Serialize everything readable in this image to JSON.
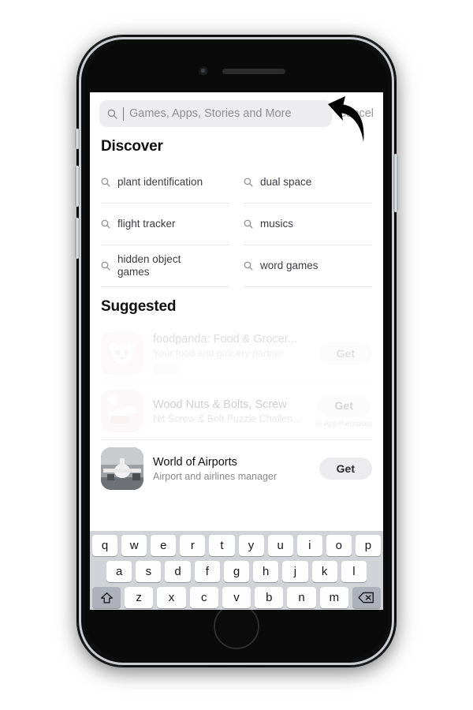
{
  "device": {
    "type": "iphone-home-button",
    "frame_color": "#111111",
    "rim_color": "#c9cdd1"
  },
  "search": {
    "placeholder": "Games, Apps, Stories and More",
    "value": "",
    "cancel_label": "Cancel",
    "icon": "search-icon"
  },
  "discover": {
    "title": "Discover",
    "items": [
      {
        "label": "plant identification",
        "icon": "search-icon"
      },
      {
        "label": "dual space",
        "icon": "search-icon"
      },
      {
        "label": "flight tracker",
        "icon": "search-icon"
      },
      {
        "label": "musics",
        "icon": "search-icon"
      },
      {
        "label": "hidden object games",
        "icon": "search-icon"
      },
      {
        "label": "word games",
        "icon": "search-icon"
      }
    ]
  },
  "suggested": {
    "title": "Suggested",
    "apps": [
      {
        "name": "foodpanda: Food & Grocer...",
        "subtitle": "Your food and grocery partner",
        "action_label": "Get",
        "note": "",
        "icon": "panda-app-icon",
        "state": "loading"
      },
      {
        "name": "Wood Nuts & Bolts, Screw",
        "subtitle": "Nit Screw & Bolt Puzzle Challenges",
        "action_label": "Get",
        "note": "In-App Purchases",
        "icon": "wood-bolts-app-icon",
        "state": "loading"
      },
      {
        "name": "World of Airports",
        "subtitle": "Airport and airlines manager",
        "action_label": "Get",
        "note": "",
        "icon": "airport-photo-app-icon",
        "state": "loaded"
      }
    ]
  },
  "keyboard": {
    "row1": [
      "q",
      "w",
      "e",
      "r",
      "t",
      "y",
      "u",
      "i",
      "o",
      "p"
    ],
    "row2": [
      "a",
      "s",
      "d",
      "f",
      "g",
      "h",
      "j",
      "k",
      "l"
    ],
    "row3": [
      "z",
      "x",
      "c",
      "v",
      "b",
      "n",
      "m"
    ],
    "shift_icon": "shift-arrow-icon",
    "backspace_icon": "backspace-icon"
  },
  "annotation": {
    "shape": "curved-arrow",
    "color": "#000000",
    "points_to": "search-field"
  },
  "colors": {
    "accent": "#ececef",
    "text_primary": "#111111",
    "text_secondary": "#8a8a8f",
    "keyboard_bg": "#d1d3d8"
  }
}
